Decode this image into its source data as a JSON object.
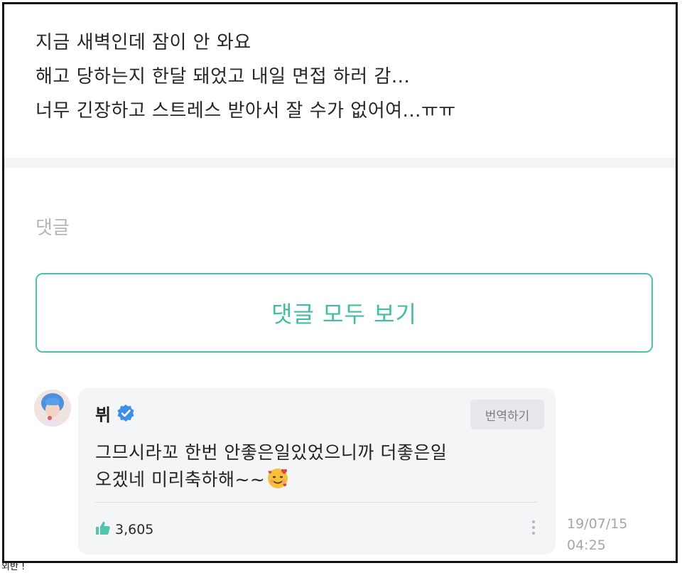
{
  "post": {
    "lines": [
      "지금 새벽인데 잠이 안 와요",
      "해고 당하는지 한달 돼었고 내일 면접 하러 감...",
      "너무 긴장하고 스트레스 받아서 잘 수가 없어여...ㅠㅠ"
    ]
  },
  "comments_section": {
    "heading": "댓글",
    "view_all_label": "댓글 모두 보기"
  },
  "comment": {
    "author": "뷔",
    "verified_icon": "verified-check-icon",
    "translate_label": "번역하기",
    "text_lines": [
      "그므시라꼬 한번 안좋은일있었으니까 더좋은일",
      "오겠네 미리축하해~~"
    ],
    "emoji_icon": "smiling-face-with-hearts-icon",
    "like_icon": "thumbs-up-icon",
    "like_count": "3,605",
    "more_icon": "vertical-ellipsis-icon",
    "date": "19/07/15",
    "time": "04:25"
  },
  "bottom_cut_text": "외반 !",
  "colors": {
    "accent": "#48c6ab",
    "verified": "#3d8ee8",
    "card_bg": "#f4f5f7"
  }
}
